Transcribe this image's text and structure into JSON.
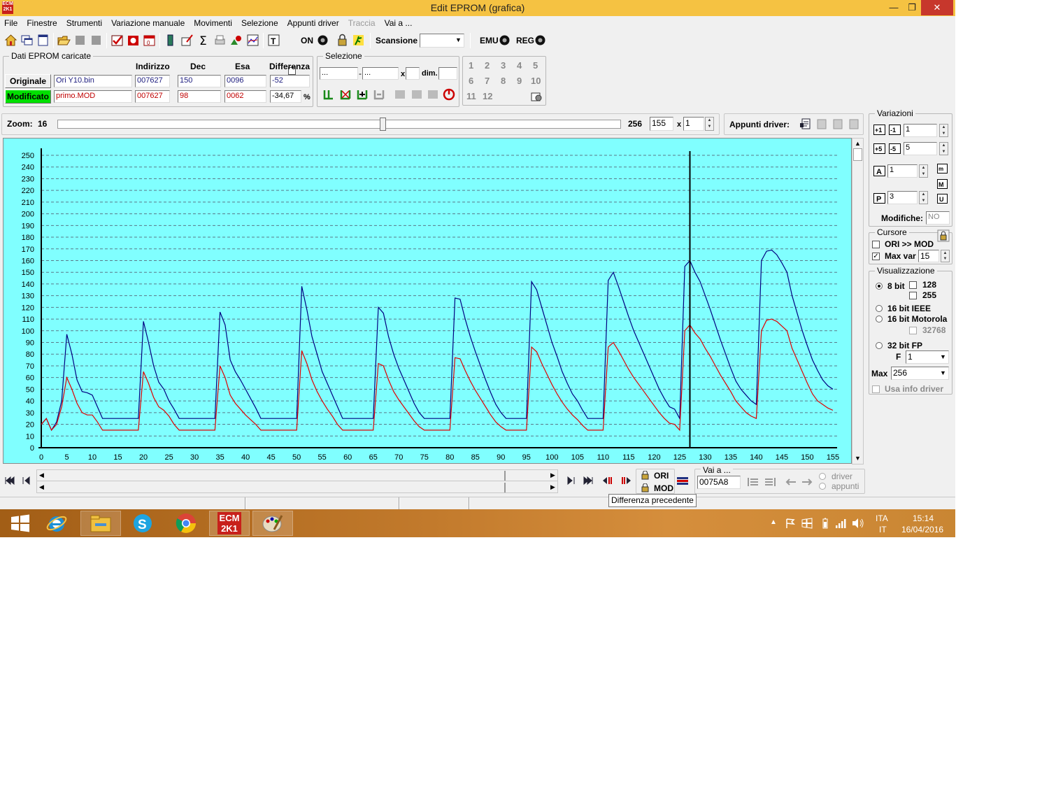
{
  "window": {
    "title": "Edit EPROM (grafica)",
    "minimize": "—",
    "maximize": "❐",
    "close": "✕"
  },
  "menu": [
    "File",
    "Finestre",
    "Strumenti",
    "Variazione manuale",
    "Movimenti",
    "Selezione",
    "Appunti driver",
    "Traccia",
    "Vai a ..."
  ],
  "toolbar": {
    "on_label": "ON",
    "scan_label": "Scansione",
    "scan_value": "",
    "emu_label": "EMU",
    "reg_label": "REG"
  },
  "eprom": {
    "group_title": "Dati EPROM caricate",
    "col_address": "Indirizzo",
    "col_dec": "Dec",
    "col_hex": "Esa",
    "col_diff": "Differenza",
    "original": {
      "label": "Originale",
      "file": "Ori Y10.bin",
      "address": "007627",
      "dec": "150",
      "hex": "0096",
      "diff": "-52"
    },
    "modified": {
      "label": "Modificato",
      "file": "primo.MOD",
      "address": "007627",
      "dec": "98",
      "hex": "0062",
      "diff": "-34,67",
      "unit": "%"
    }
  },
  "selection": {
    "title": "Selezione",
    "from": "...",
    "dash": "-",
    "to": "...",
    "x": "x",
    "dim_label": "dim."
  },
  "numbers": [
    "1",
    "2",
    "3",
    "4",
    "5",
    "6",
    "7",
    "8",
    "9",
    "10",
    "11",
    "12"
  ],
  "zoom": {
    "label": "Zoom:",
    "value": "16",
    "max": "256",
    "field": "155",
    "x": "x",
    "mult": "1",
    "slider_position": 0.577
  },
  "clipboard": {
    "label": "Appunti driver:"
  },
  "variazioni": {
    "title": "Variazioni",
    "v1": "1",
    "v2": "5",
    "v3": "1",
    "v4": "3",
    "modifiche_label": "Modifiche:",
    "modifiche_value": "NO"
  },
  "cursore": {
    "title": "Cursore",
    "ori_mod": "ORI >> MOD",
    "ori_mod_checked": false,
    "maxvar_label": "Max var",
    "maxvar_checked": true,
    "maxvar_value": "15"
  },
  "visualizzazione": {
    "title": "Visualizzazione",
    "bit8": "8 bit",
    "opt128": "128",
    "opt255": "255",
    "ieee": "16 bit IEEE",
    "motorola": "16 bit Motorola",
    "opt32768": "32768",
    "fp32": "32 bit FP",
    "f_label": "F",
    "f_value": "1",
    "max_label": "Max",
    "max_value": "256",
    "usa_info": "Usa info driver",
    "selected": "8 bit"
  },
  "nav": {
    "ori": "ORI",
    "mod": "MOD",
    "goto_label": "Vai a ...",
    "goto_value": "0075A8",
    "driver": "driver",
    "appunti": "appunti"
  },
  "tooltip": "Differenza precedente",
  "taskbar": {
    "lang1": "ITA",
    "lang2": "IT",
    "time": "15:14",
    "date": "16/04/2016"
  },
  "colors": {
    "plot_bg": "#80ffff",
    "original_series": "#000080",
    "modified_series": "#e00000",
    "modified_button": "#00e000",
    "titlebar": "#f5c242"
  },
  "chart_data": {
    "type": "line",
    "xlim": [
      0,
      155
    ],
    "ylim": [
      0,
      250
    ],
    "x_ticks": [
      0,
      5,
      10,
      15,
      20,
      25,
      30,
      35,
      40,
      45,
      50,
      55,
      60,
      65,
      70,
      75,
      80,
      85,
      90,
      95,
      100,
      105,
      110,
      115,
      120,
      125,
      130,
      135,
      140,
      145,
      150,
      155
    ],
    "y_ticks": [
      0,
      10,
      20,
      30,
      40,
      50,
      60,
      70,
      80,
      90,
      100,
      110,
      120,
      130,
      140,
      150,
      160,
      170,
      180,
      190,
      200,
      210,
      220,
      230,
      240,
      250
    ],
    "grid": true,
    "cursor_x": 127,
    "series": [
      {
        "key": "original",
        "points": [
          [
            0,
            20
          ],
          [
            1,
            25
          ],
          [
            2,
            15
          ],
          [
            3,
            22
          ],
          [
            4,
            40
          ],
          [
            5,
            97
          ],
          [
            6,
            80
          ],
          [
            7,
            58
          ],
          [
            8,
            48
          ],
          [
            9,
            47
          ],
          [
            10,
            45
          ],
          [
            11,
            35
          ],
          [
            12,
            25
          ],
          [
            19,
            25
          ],
          [
            20,
            108
          ],
          [
            21,
            90
          ],
          [
            22,
            70
          ],
          [
            23,
            56
          ],
          [
            24,
            50
          ],
          [
            25,
            40
          ],
          [
            26,
            33
          ],
          [
            27,
            25
          ],
          [
            34,
            25
          ],
          [
            35,
            116
          ],
          [
            36,
            105
          ],
          [
            37,
            75
          ],
          [
            38,
            65
          ],
          [
            39,
            58
          ],
          [
            40,
            50
          ],
          [
            41,
            42
          ],
          [
            42,
            34
          ],
          [
            43,
            25
          ],
          [
            50,
            25
          ],
          [
            51,
            138
          ],
          [
            52,
            118
          ],
          [
            53,
            95
          ],
          [
            54,
            80
          ],
          [
            55,
            65
          ],
          [
            56,
            55
          ],
          [
            57,
            45
          ],
          [
            58,
            35
          ],
          [
            59,
            25
          ],
          [
            65,
            25
          ],
          [
            66,
            120
          ],
          [
            67,
            115
          ],
          [
            68,
            95
          ],
          [
            69,
            80
          ],
          [
            70,
            68
          ],
          [
            71,
            58
          ],
          [
            72,
            48
          ],
          [
            73,
            38
          ],
          [
            74,
            30
          ],
          [
            75,
            25
          ],
          [
            80,
            25
          ],
          [
            81,
            128
          ],
          [
            82,
            127
          ],
          [
            83,
            110
          ],
          [
            84,
            95
          ],
          [
            85,
            82
          ],
          [
            86,
            70
          ],
          [
            87,
            58
          ],
          [
            88,
            47
          ],
          [
            89,
            37
          ],
          [
            90,
            30
          ],
          [
            91,
            25
          ],
          [
            95,
            25
          ],
          [
            96,
            142
          ],
          [
            97,
            135
          ],
          [
            98,
            120
          ],
          [
            99,
            105
          ],
          [
            100,
            90
          ],
          [
            101,
            78
          ],
          [
            102,
            65
          ],
          [
            103,
            55
          ],
          [
            104,
            46
          ],
          [
            105,
            40
          ],
          [
            106,
            32
          ],
          [
            107,
            25
          ],
          [
            110,
            25
          ],
          [
            111,
            143
          ],
          [
            112,
            150
          ],
          [
            113,
            138
          ],
          [
            114,
            125
          ],
          [
            115,
            112
          ],
          [
            116,
            100
          ],
          [
            117,
            90
          ],
          [
            118,
            80
          ],
          [
            119,
            70
          ],
          [
            120,
            60
          ],
          [
            121,
            50
          ],
          [
            122,
            42
          ],
          [
            123,
            35
          ],
          [
            124,
            33
          ],
          [
            125,
            25
          ],
          [
            126,
            155
          ],
          [
            127,
            160
          ],
          [
            128,
            150
          ],
          [
            129,
            142
          ],
          [
            130,
            130
          ],
          [
            131,
            118
          ],
          [
            132,
            105
          ],
          [
            133,
            92
          ],
          [
            134,
            80
          ],
          [
            135,
            68
          ],
          [
            136,
            57
          ],
          [
            137,
            50
          ],
          [
            138,
            45
          ],
          [
            139,
            40
          ],
          [
            140,
            37
          ],
          [
            141,
            160
          ],
          [
            142,
            168
          ],
          [
            143,
            169
          ],
          [
            144,
            165
          ],
          [
            145,
            158
          ],
          [
            146,
            150
          ],
          [
            147,
            130
          ],
          [
            148,
            115
          ],
          [
            149,
            100
          ],
          [
            150,
            87
          ],
          [
            151,
            75
          ],
          [
            152,
            66
          ],
          [
            153,
            58
          ],
          [
            154,
            53
          ],
          [
            155,
            50
          ]
        ]
      },
      {
        "key": "modified",
        "points": [
          [
            0,
            20
          ],
          [
            1,
            25
          ],
          [
            2,
            15
          ],
          [
            3,
            20
          ],
          [
            4,
            35
          ],
          [
            5,
            60
          ],
          [
            6,
            50
          ],
          [
            7,
            38
          ],
          [
            8,
            30
          ],
          [
            9,
            28
          ],
          [
            10,
            28
          ],
          [
            11,
            22
          ],
          [
            12,
            15
          ],
          [
            19,
            15
          ],
          [
            20,
            65
          ],
          [
            21,
            55
          ],
          [
            22,
            43
          ],
          [
            23,
            35
          ],
          [
            24,
            32
          ],
          [
            25,
            27
          ],
          [
            26,
            20
          ],
          [
            27,
            15
          ],
          [
            34,
            15
          ],
          [
            35,
            70
          ],
          [
            36,
            60
          ],
          [
            37,
            45
          ],
          [
            38,
            38
          ],
          [
            39,
            33
          ],
          [
            40,
            28
          ],
          [
            41,
            24
          ],
          [
            42,
            20
          ],
          [
            43,
            15
          ],
          [
            50,
            15
          ],
          [
            51,
            83
          ],
          [
            52,
            72
          ],
          [
            53,
            58
          ],
          [
            54,
            48
          ],
          [
            55,
            40
          ],
          [
            56,
            33
          ],
          [
            57,
            27
          ],
          [
            58,
            20
          ],
          [
            59,
            15
          ],
          [
            65,
            15
          ],
          [
            66,
            72
          ],
          [
            67,
            70
          ],
          [
            68,
            58
          ],
          [
            69,
            48
          ],
          [
            70,
            41
          ],
          [
            71,
            35
          ],
          [
            72,
            29
          ],
          [
            73,
            23
          ],
          [
            74,
            18
          ],
          [
            75,
            15
          ],
          [
            80,
            15
          ],
          [
            81,
            77
          ],
          [
            82,
            76
          ],
          [
            83,
            66
          ],
          [
            84,
            57
          ],
          [
            85,
            49
          ],
          [
            86,
            42
          ],
          [
            87,
            35
          ],
          [
            88,
            28
          ],
          [
            89,
            22
          ],
          [
            90,
            18
          ],
          [
            91,
            15
          ],
          [
            95,
            15
          ],
          [
            96,
            86
          ],
          [
            97,
            82
          ],
          [
            98,
            72
          ],
          [
            99,
            63
          ],
          [
            100,
            54
          ],
          [
            101,
            46
          ],
          [
            102,
            39
          ],
          [
            103,
            33
          ],
          [
            104,
            28
          ],
          [
            105,
            24
          ],
          [
            106,
            19
          ],
          [
            107,
            15
          ],
          [
            110,
            15
          ],
          [
            111,
            86
          ],
          [
            112,
            90
          ],
          [
            113,
            83
          ],
          [
            114,
            75
          ],
          [
            115,
            67
          ],
          [
            116,
            60
          ],
          [
            117,
            54
          ],
          [
            118,
            48
          ],
          [
            119,
            42
          ],
          [
            120,
            36
          ],
          [
            121,
            30
          ],
          [
            122,
            25
          ],
          [
            123,
            21
          ],
          [
            124,
            20
          ],
          [
            125,
            15
          ],
          [
            126,
            100
          ],
          [
            127,
            105
          ],
          [
            128,
            98
          ],
          [
            129,
            93
          ],
          [
            130,
            85
          ],
          [
            131,
            78
          ],
          [
            132,
            70
          ],
          [
            133,
            62
          ],
          [
            134,
            55
          ],
          [
            135,
            48
          ],
          [
            136,
            40
          ],
          [
            137,
            35
          ],
          [
            138,
            30
          ],
          [
            139,
            27
          ],
          [
            140,
            25
          ],
          [
            141,
            100
          ],
          [
            142,
            109
          ],
          [
            143,
            110
          ],
          [
            144,
            108
          ],
          [
            145,
            104
          ],
          [
            146,
            100
          ],
          [
            147,
            85
          ],
          [
            148,
            75
          ],
          [
            149,
            65
          ],
          [
            150,
            55
          ],
          [
            151,
            46
          ],
          [
            152,
            40
          ],
          [
            153,
            37
          ],
          [
            154,
            34
          ],
          [
            155,
            32
          ]
        ]
      }
    ]
  }
}
